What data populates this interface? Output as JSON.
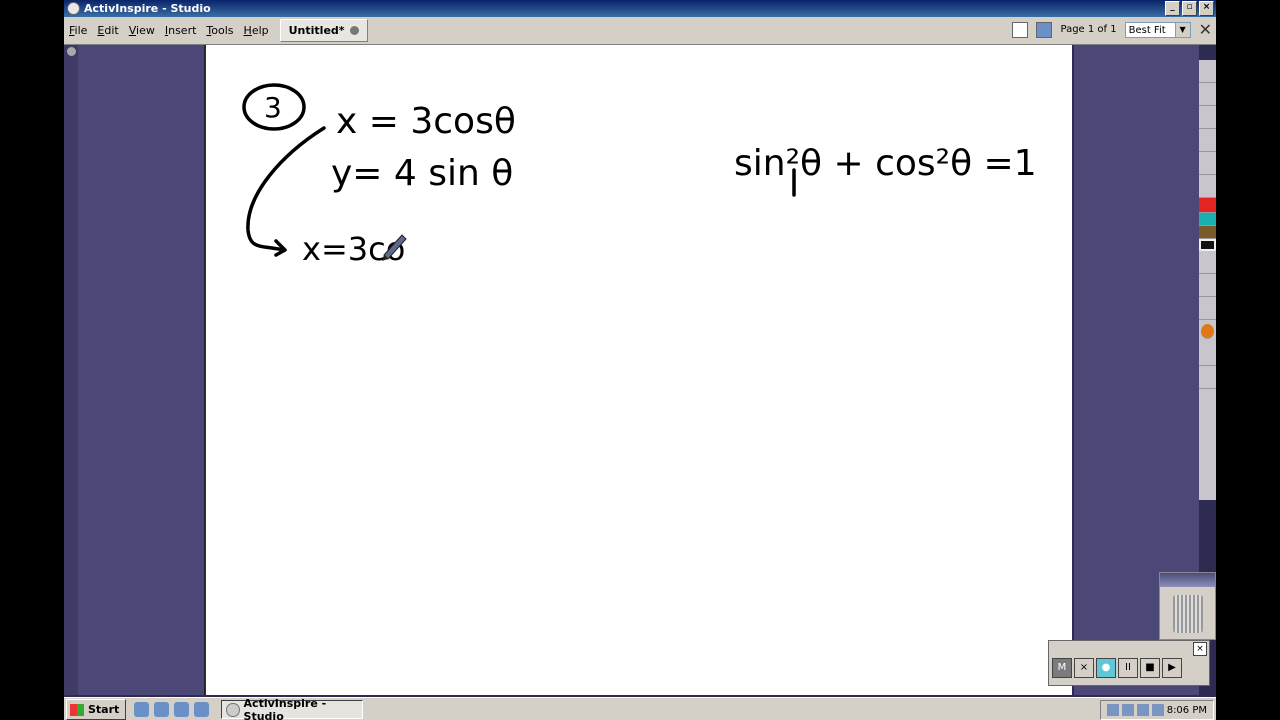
{
  "window": {
    "title": "ActivInspire - Studio"
  },
  "menu": {
    "items": [
      "File",
      "Edit",
      "View",
      "Insert",
      "Tools",
      "Help"
    ]
  },
  "document_tab": {
    "label": "Untitled*"
  },
  "page_indicator": "Page 1 of 1",
  "zoom": {
    "selected": "Best Fit"
  },
  "handwriting": {
    "problem_number": "3",
    "line1": "x = 3cosθ",
    "line2": "y= 4 sin θ",
    "line3": "x=3co",
    "identity": "sin²θ + cos²θ =1"
  },
  "recorder": {
    "buttons": [
      "M",
      "×",
      "●",
      "II",
      "■",
      "▶"
    ]
  },
  "taskbar": {
    "start_label": "Start",
    "task_label": "ActivInspire - Studio",
    "clock": "8:06 PM"
  },
  "colors": {
    "page_bg": "#ffffff",
    "panel": "#4b4878",
    "ink": "#000000"
  }
}
